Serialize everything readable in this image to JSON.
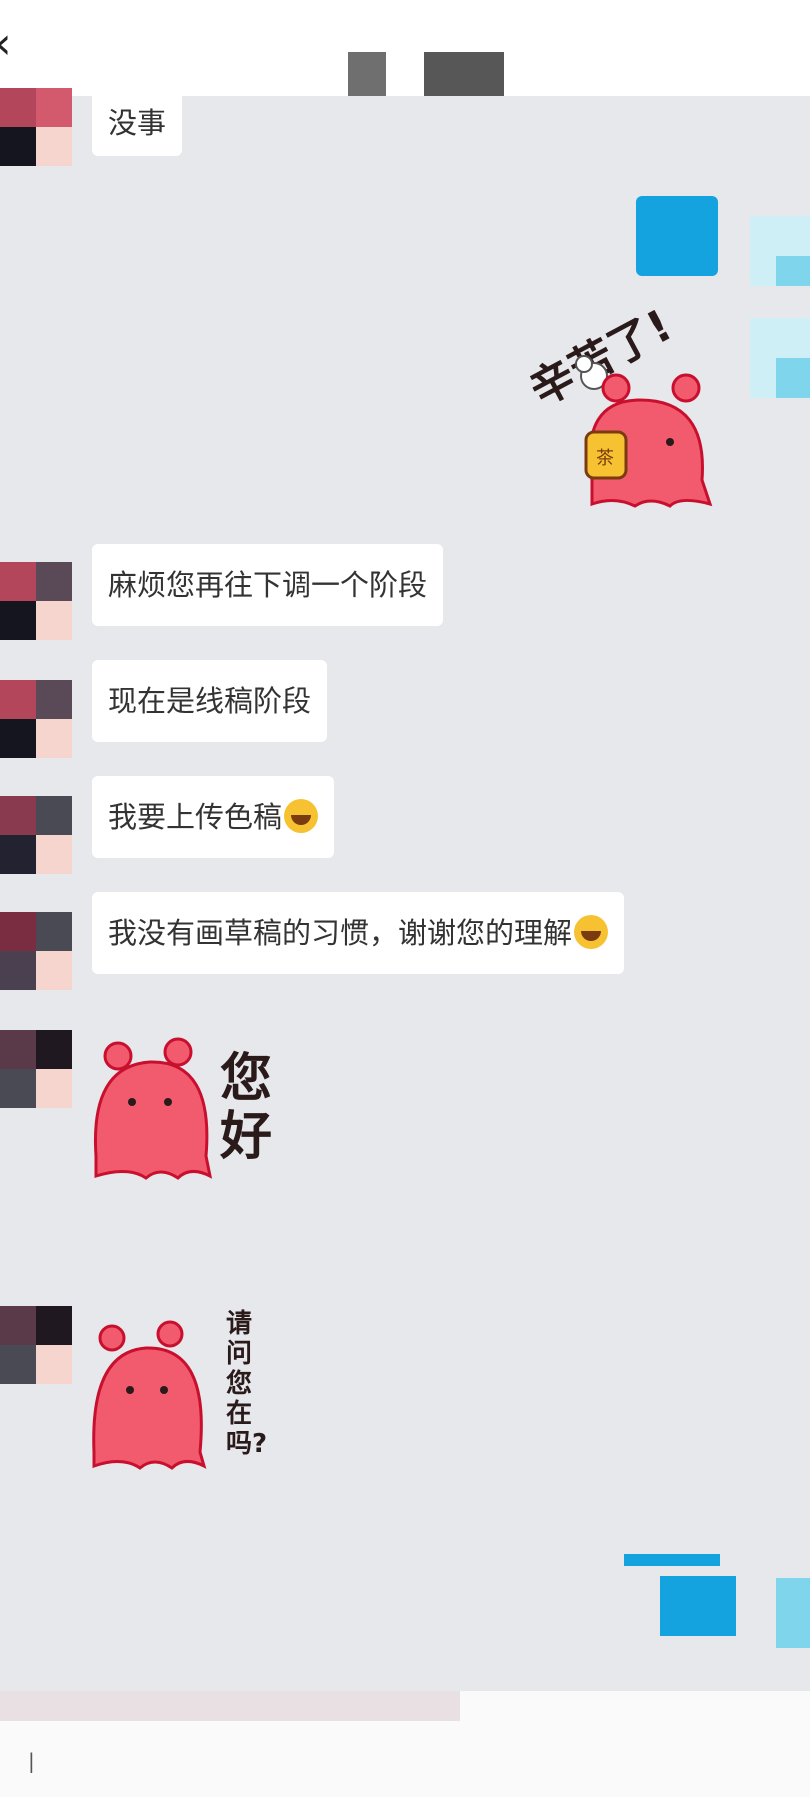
{
  "header": {
    "back_icon": "chevron-left-icon"
  },
  "messages": [
    {
      "side": "left",
      "type": "text",
      "text": "没事"
    },
    {
      "side": "right",
      "type": "sticker",
      "caption": "辛苦了!",
      "tea_label": "茶"
    },
    {
      "side": "left",
      "type": "text",
      "text": "麻烦您再往下调一个阶段"
    },
    {
      "side": "left",
      "type": "text",
      "text": "现在是线稿阶段"
    },
    {
      "side": "left",
      "type": "text",
      "text": "我要上传色稿",
      "emoji": "grinning-emoji"
    },
    {
      "side": "left",
      "type": "text",
      "text": "我没有画草稿的习惯，谢谢您的理解",
      "emoji": "grinning-emoji"
    },
    {
      "side": "left",
      "type": "sticker",
      "caption_lines": [
        "您",
        "好"
      ]
    },
    {
      "side": "left",
      "type": "sticker",
      "caption_lines": [
        "请",
        "问",
        "您",
        "在",
        "吗?"
      ]
    }
  ],
  "colors": {
    "chat_bg": "#e6e8ec",
    "bubble_bg": "#ffffff",
    "sticker_pink": "#f25a6e",
    "sticker_dark": "#c8102e",
    "accent_blue": "#15a3e0"
  }
}
